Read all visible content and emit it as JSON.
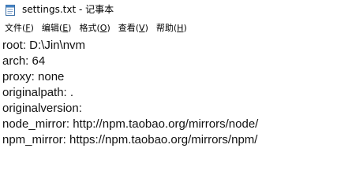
{
  "window": {
    "title": "settings.txt - 记事本",
    "icon": "notepad-icon"
  },
  "menu": {
    "items": [
      {
        "label": "文件",
        "key": "F"
      },
      {
        "label": "编辑",
        "key": "E"
      },
      {
        "label": "格式",
        "key": "O"
      },
      {
        "label": "查看",
        "key": "V"
      },
      {
        "label": "帮助",
        "key": "H"
      }
    ]
  },
  "document": {
    "lines": [
      "root: D:\\Jin\\nvm",
      "arch: 64",
      "proxy: none",
      "originalpath: .",
      "originalversion:",
      "node_mirror: http://npm.taobao.org/mirrors/node/",
      "npm_mirror: https://npm.taobao.org/mirrors/npm/"
    ]
  },
  "colors": {
    "background": "#ffffff",
    "text": "#111111"
  }
}
